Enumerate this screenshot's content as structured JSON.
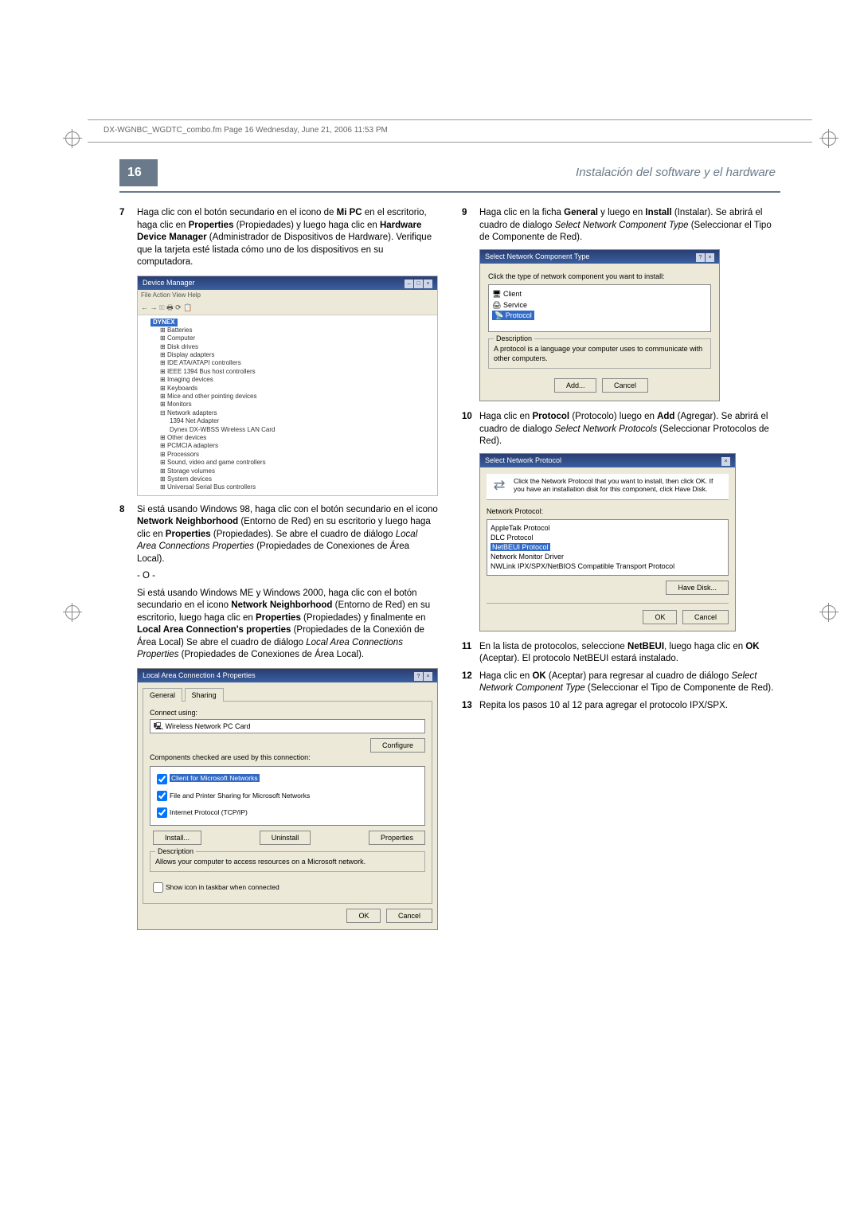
{
  "header_text": "DX-WGNBC_WGDTC_combo.fm  Page 16  Wednesday, June 21, 2006  11:53 PM",
  "page_number": "16",
  "section_title": "Instalación del software y el hardware",
  "left_col": {
    "step7": {
      "num": "7",
      "text_a": "Haga clic con el botón secundario en el icono de ",
      "bold_a": "Mi PC",
      "text_b": " en el escritorio, haga clic en ",
      "bold_b": "Properties",
      "text_c": " (Propiedades) y luego haga clic en ",
      "bold_c": "Hardware Device Manager",
      "text_d": " (Administrador de Dispositivos de Hardware). Verifique que la tarjeta esté listada cómo uno de los dispositivos en su computadora."
    },
    "devmgr": {
      "title": "Device Manager",
      "menu": "File   Action   View   Help",
      "toolbar": "←  →   🗉  🖶  ⟳  📋",
      "root": "DYNEX",
      "items": [
        "Batteries",
        "Computer",
        "Disk drives",
        "Display adapters",
        "IDE ATA/ATAPI controllers",
        "IEEE 1394 Bus host controllers",
        "Imaging devices",
        "Keyboards",
        "Mice and other pointing devices",
        "Monitors"
      ],
      "net_label": "Network adapters",
      "net_items": [
        "1394 Net Adapter",
        "Dynex DX-WBSS Wireless LAN Card"
      ],
      "items2": [
        "Other devices",
        "PCMCIA adapters",
        "Processors",
        "Sound, video and game controllers",
        "Storage volumes",
        "System devices",
        "Universal Serial Bus controllers"
      ]
    },
    "step8": {
      "num": "8",
      "text_a": "Si está usando Windows 98, haga clic con el botón secundario en el icono ",
      "bold_a": "Network Neighborhood",
      "text_b": " (Entorno de Red) en su escritorio y luego haga clic en ",
      "bold_b": "Properties",
      "text_c": " (Propiedades). Se abre el cuadro de diálogo ",
      "ital_a": "Local Area Connections Properties",
      "text_d": " (Propiedades de Conexiones de Área Local).",
      "dash": "- O -",
      "text_e": "Si está usando Windows ME y Windows 2000, haga clic con el botón secundario en el icono ",
      "bold_c": "Network Neighborhood",
      "text_f": " (Entorno de Red) en su escritorio, luego haga clic en ",
      "bold_d": "Properties",
      "text_g": " (Propiedades) y finalmente en ",
      "bold_e": "Local Area Connection's properties",
      "text_h": " (Propiedades de la Conexión de Área Local)  Se abre el cuadro de diálogo ",
      "ital_b": "Local Area Connections Properties",
      "text_i": " (Propiedades de Conexiones de Área Local)."
    },
    "lac": {
      "title": "Local Area Connection 4 Properties",
      "tab_general": "General",
      "tab_sharing": "Sharing",
      "connect_using": "Connect using:",
      "adapter": "Wireless Network PC Card",
      "configure_btn": "Configure",
      "components_label": "Components checked are used by this connection:",
      "comp1": "Client for Microsoft Networks",
      "comp2": "File and Printer Sharing for Microsoft Networks",
      "comp3": "Internet Protocol (TCP/IP)",
      "install_btn": "Install...",
      "uninstall_btn": "Uninstall",
      "properties_btn": "Properties",
      "desc_title": "Description",
      "desc_text": "Allows your computer to access resources on a Microsoft network.",
      "show_icon": "Show icon in taskbar when connected",
      "ok": "OK",
      "cancel": "Cancel"
    }
  },
  "right_col": {
    "step9": {
      "num": "9",
      "text_a": "Haga clic en la ficha ",
      "bold_a": "General",
      "text_b": " y luego en ",
      "bold_b": "Install",
      "text_c": " (Instalar). Se abrirá el cuadro de dialogo ",
      "ital_a": "Select Network Component Type",
      "text_d": " (Seleccionar el Tipo de Componente de Red)."
    },
    "snct": {
      "title": "Select Network Component Type",
      "instr": "Click the type of network component you want to install:",
      "client": "Client",
      "service": "Service",
      "protocol": "Protocol",
      "desc_title": "Description",
      "desc_text": "A protocol is a language your computer uses to communicate with other computers.",
      "add": "Add...",
      "cancel": "Cancel"
    },
    "step10": {
      "num": "10",
      "text_a": "Haga clic en ",
      "bold_a": "Protocol",
      "text_b": " (Protocolo) luego en ",
      "bold_b": "Add",
      "text_c": " (Agregar). Se abrirá el cuadro de dialogo ",
      "ital_a": "Select Network Protocols",
      "text_d": " (Seleccionar Protocolos de Red)."
    },
    "snp": {
      "title": "Select Network Protocol",
      "instr": "Click the Network Protocol that you want to install, then click OK. If you have an installation disk for this component, click Have Disk.",
      "list_label": "Network Protocol:",
      "items": [
        "AppleTalk Protocol",
        "DLC Protocol"
      ],
      "sel": "NetBEUI Protocol",
      "items2": [
        "Network Monitor Driver",
        "NWLink IPX/SPX/NetBIOS Compatible Transport Protocol"
      ],
      "have_disk": "Have Disk...",
      "ok": "OK",
      "cancel": "Cancel"
    },
    "step11": {
      "num": "11",
      "text_a": "En la lista de protocolos, seleccione ",
      "bold_a": "NetBEUI",
      "text_b": ", luego haga clic en ",
      "bold_b": "OK",
      "text_c": " (Aceptar). El protocolo NetBEUI estará instalado."
    },
    "step12": {
      "num": "12",
      "text_a": "Haga clic en ",
      "bold_a": "OK",
      "text_b": " (Aceptar) para regresar al cuadro de diálogo ",
      "ital_a": "Select Network Component Type",
      "text_c": " (Seleccionar el Tipo de Componente de Red)."
    },
    "step13": {
      "num": "13",
      "text": "Repita los pasos 10 al 12 para agregar el protocolo IPX/SPX."
    }
  }
}
